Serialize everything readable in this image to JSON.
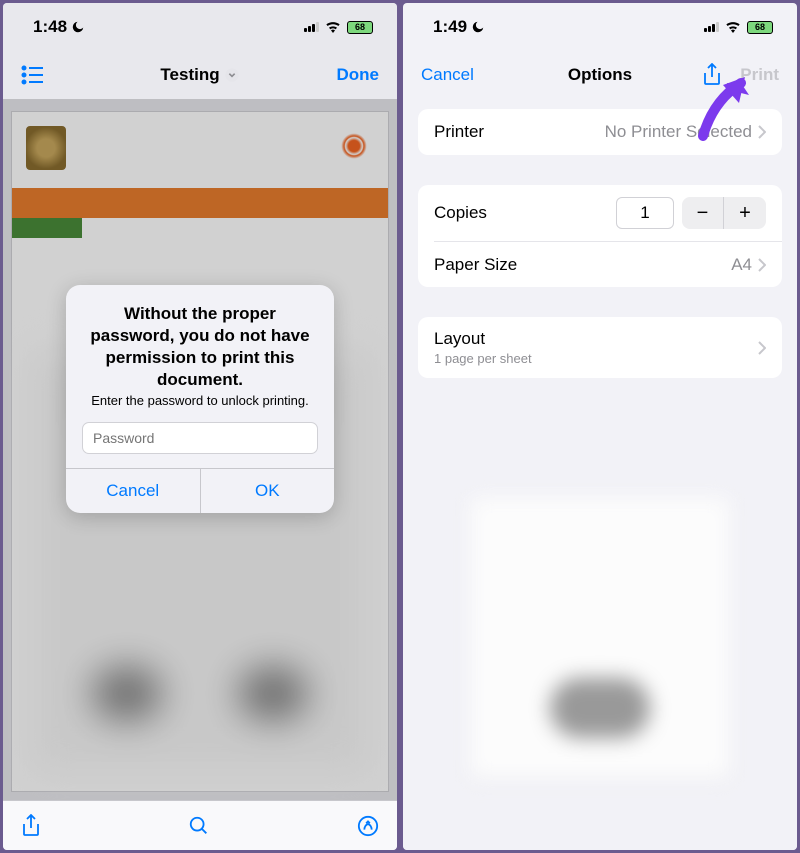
{
  "left": {
    "status": {
      "time": "1:48",
      "battery": "68"
    },
    "nav": {
      "title": "Testing",
      "done": "Done"
    },
    "alert": {
      "title": "Without the proper password, you do not have permission to print this document.",
      "message": "Enter the password to unlock printing.",
      "placeholder": "Password",
      "cancel": "Cancel",
      "ok": "OK"
    }
  },
  "right": {
    "status": {
      "time": "1:49",
      "battery": "68"
    },
    "nav": {
      "cancel": "Cancel",
      "title": "Options",
      "print": "Print"
    },
    "printer": {
      "label": "Printer",
      "value": "No Printer Selected"
    },
    "copies": {
      "label": "Copies",
      "value": "1"
    },
    "paperSize": {
      "label": "Paper Size",
      "value": "A4"
    },
    "layout": {
      "label": "Layout",
      "sublabel": "1 page per sheet"
    }
  }
}
